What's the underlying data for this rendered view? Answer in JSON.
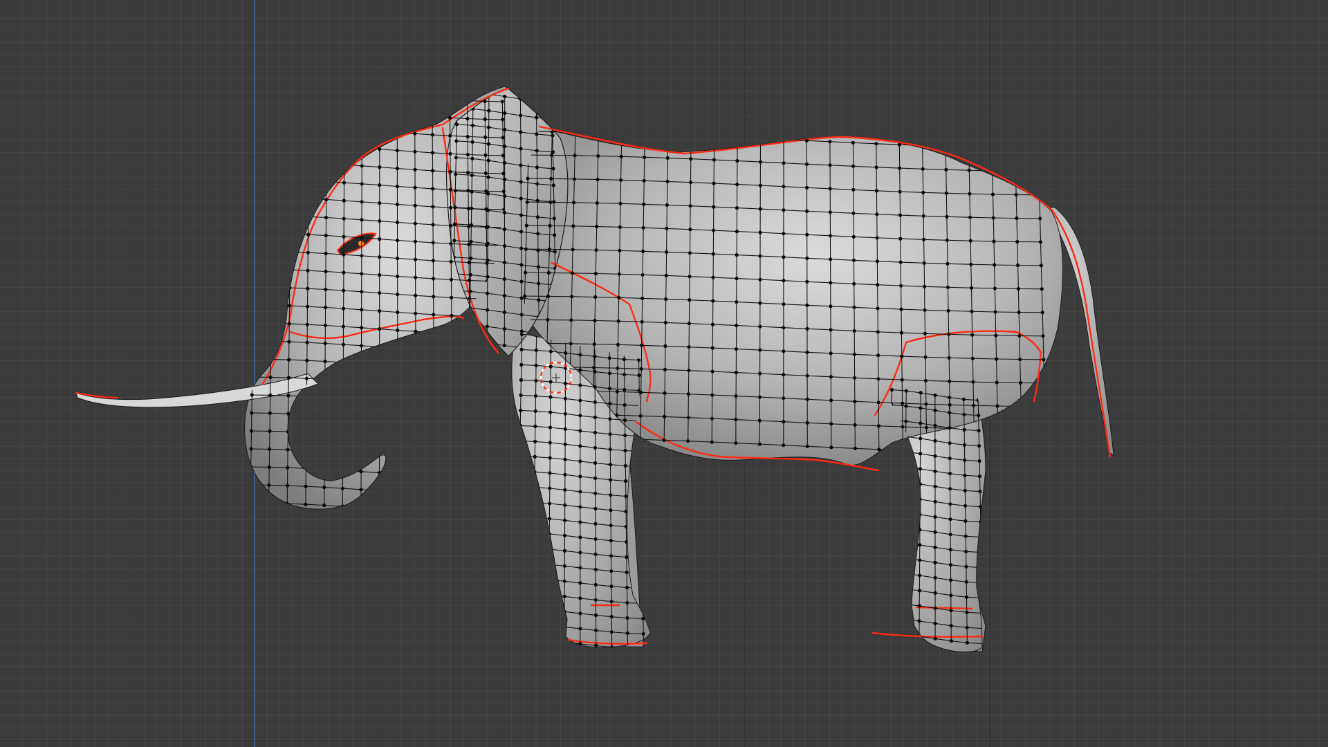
{
  "viewport": {
    "mode": "edit-mode",
    "view": "right-orthographic",
    "object": "elephant-mesh",
    "background_color": "#3b3b3b",
    "grid_minor_color": "#434343",
    "grid_major_color": "#2f2f2f",
    "z_axis_color": "#3f5f93",
    "mesh_face_color": "#b9b9b9",
    "seam_color": "#ff2a12",
    "vertex_color": "#0a0a0a",
    "selected_vertex_color": "#ff8a1c",
    "cursor_icon": "3d-cursor-icon"
  }
}
